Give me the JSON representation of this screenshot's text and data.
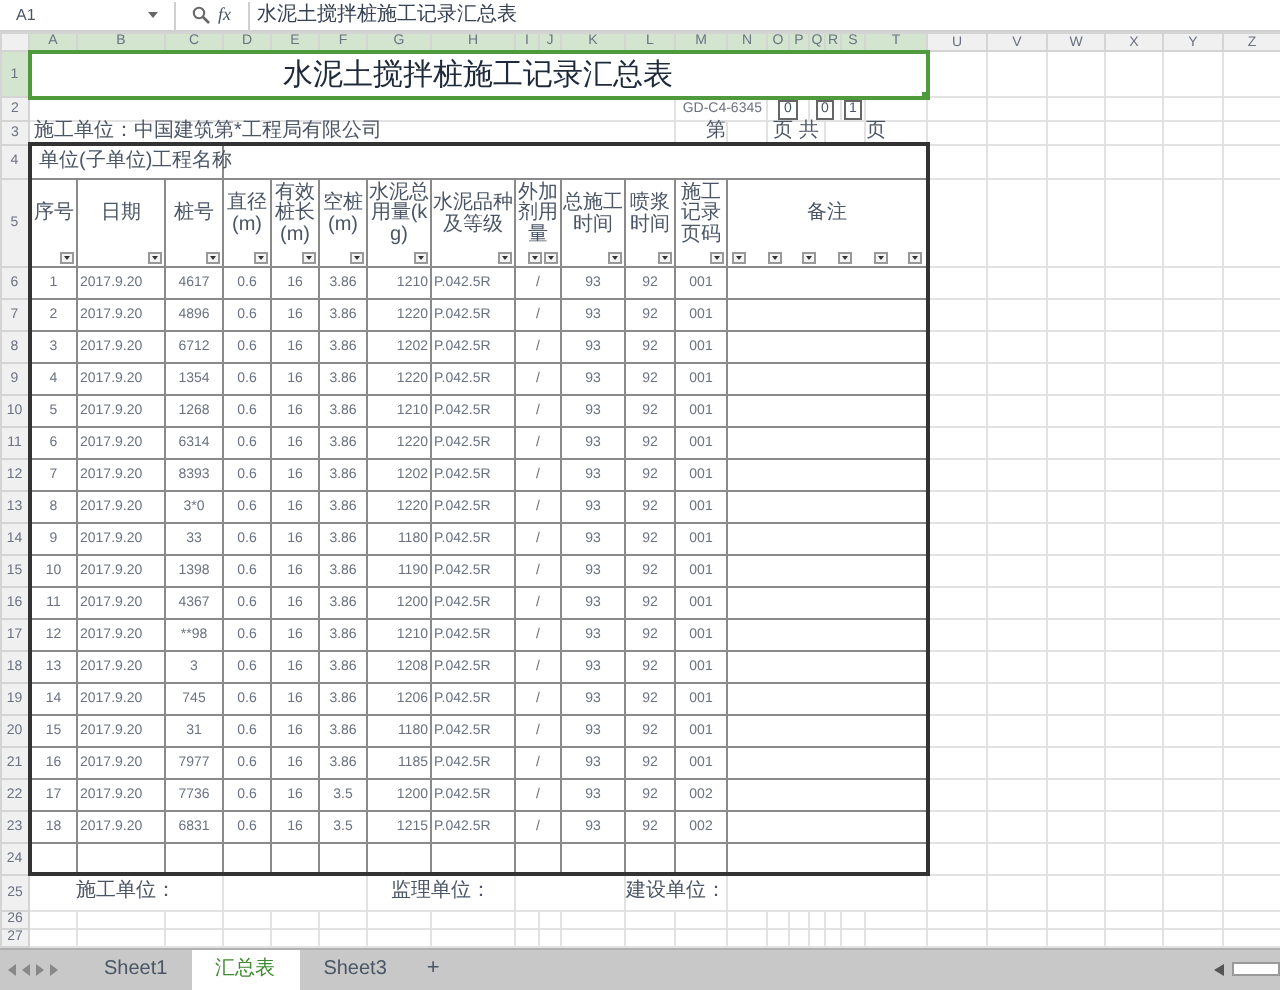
{
  "toolbar": {
    "name_box": "A1",
    "fx_label": "fx",
    "formula": "水泥土搅拌桩施工记录汇总表"
  },
  "column_letters": [
    "A",
    "B",
    "C",
    "D",
    "E",
    "F",
    "G",
    "H",
    "I",
    "J",
    "K",
    "L",
    "M",
    "N",
    "O",
    "P",
    "Q",
    "R",
    "S",
    "T",
    "U",
    "V",
    "W",
    "X",
    "Y",
    "Z"
  ],
  "row_numbers": [
    "1",
    "2",
    "3",
    "4",
    "5",
    "6",
    "7",
    "8",
    "9",
    "10",
    "11",
    "12",
    "13",
    "14",
    "15",
    "16",
    "17",
    "18",
    "19",
    "20",
    "21",
    "22",
    "23",
    "24",
    "25",
    "26",
    "27"
  ],
  "title": {
    "text": "水泥土搅拌桩施工记录汇总表",
    "selected": true
  },
  "form_code": "GD-C4-6345",
  "code_boxes": [
    "0",
    "0",
    "1"
  ],
  "construction_unit": "施工单位：中国建筑第*工程局有限公司",
  "page_labels": [
    "第",
    "页 共",
    "页"
  ],
  "project_name_label": "单位(子单位)工程名称",
  "headers": [
    "序号",
    "日期",
    "桩号",
    "直径(m)",
    "有效桩长(m)",
    "空桩(m)",
    "水泥总用量(kg)",
    "水泥品种及等级",
    "外加剂用量",
    "总施工时间",
    "喷浆时间",
    "施工记录页码",
    "备注"
  ],
  "rows": [
    {
      "no": "1",
      "date": "2017.9.20",
      "pile": "4617",
      "diameter": "0.6",
      "length": "16",
      "empty": "3.86",
      "cement": "1210",
      "grade": "P.042.5R",
      "additive": "/",
      "total_time": "93",
      "spray_time": "92",
      "page": "001"
    },
    {
      "no": "2",
      "date": "2017.9.20",
      "pile": "4896",
      "diameter": "0.6",
      "length": "16",
      "empty": "3.86",
      "cement": "1220",
      "grade": "P.042.5R",
      "additive": "/",
      "total_time": "93",
      "spray_time": "92",
      "page": "001"
    },
    {
      "no": "3",
      "date": "2017.9.20",
      "pile": "6712",
      "diameter": "0.6",
      "length": "16",
      "empty": "3.86",
      "cement": "1202",
      "grade": "P.042.5R",
      "additive": "/",
      "total_time": "93",
      "spray_time": "92",
      "page": "001"
    },
    {
      "no": "4",
      "date": "2017.9.20",
      "pile": "1354",
      "diameter": "0.6",
      "length": "16",
      "empty": "3.86",
      "cement": "1220",
      "grade": "P.042.5R",
      "additive": "/",
      "total_time": "93",
      "spray_time": "92",
      "page": "001"
    },
    {
      "no": "5",
      "date": "2017.9.20",
      "pile": "1268",
      "diameter": "0.6",
      "length": "16",
      "empty": "3.86",
      "cement": "1210",
      "grade": "P.042.5R",
      "additive": "/",
      "total_time": "93",
      "spray_time": "92",
      "page": "001"
    },
    {
      "no": "6",
      "date": "2017.9.20",
      "pile": "6314",
      "diameter": "0.6",
      "length": "16",
      "empty": "3.86",
      "cement": "1220",
      "grade": "P.042.5R",
      "additive": "/",
      "total_time": "93",
      "spray_time": "92",
      "page": "001"
    },
    {
      "no": "7",
      "date": "2017.9.20",
      "pile": "8393",
      "diameter": "0.6",
      "length": "16",
      "empty": "3.86",
      "cement": "1202",
      "grade": "P.042.5R",
      "additive": "/",
      "total_time": "93",
      "spray_time": "92",
      "page": "001"
    },
    {
      "no": "8",
      "date": "2017.9.20",
      "pile": "3*0",
      "diameter": "0.6",
      "length": "16",
      "empty": "3.86",
      "cement": "1220",
      "grade": "P.042.5R",
      "additive": "/",
      "total_time": "93",
      "spray_time": "92",
      "page": "001"
    },
    {
      "no": "9",
      "date": "2017.9.20",
      "pile": "33",
      "diameter": "0.6",
      "length": "16",
      "empty": "3.86",
      "cement": "1180",
      "grade": "P.042.5R",
      "additive": "/",
      "total_time": "93",
      "spray_time": "92",
      "page": "001"
    },
    {
      "no": "10",
      "date": "2017.9.20",
      "pile": "1398",
      "diameter": "0.6",
      "length": "16",
      "empty": "3.86",
      "cement": "1190",
      "grade": "P.042.5R",
      "additive": "/",
      "total_time": "93",
      "spray_time": "92",
      "page": "001"
    },
    {
      "no": "11",
      "date": "2017.9.20",
      "pile": "4367",
      "diameter": "0.6",
      "length": "16",
      "empty": "3.86",
      "cement": "1200",
      "grade": "P.042.5R",
      "additive": "/",
      "total_time": "93",
      "spray_time": "92",
      "page": "001"
    },
    {
      "no": "12",
      "date": "2017.9.20",
      "pile": "**98",
      "diameter": "0.6",
      "length": "16",
      "empty": "3.86",
      "cement": "1210",
      "grade": "P.042.5R",
      "additive": "/",
      "total_time": "93",
      "spray_time": "92",
      "page": "001"
    },
    {
      "no": "13",
      "date": "2017.9.20",
      "pile": "3",
      "diameter": "0.6",
      "length": "16",
      "empty": "3.86",
      "cement": "1208",
      "grade": "P.042.5R",
      "additive": "/",
      "total_time": "93",
      "spray_time": "92",
      "page": "001"
    },
    {
      "no": "14",
      "date": "2017.9.20",
      "pile": "745",
      "diameter": "0.6",
      "length": "16",
      "empty": "3.86",
      "cement": "1206",
      "grade": "P.042.5R",
      "additive": "/",
      "total_time": "93",
      "spray_time": "92",
      "page": "001"
    },
    {
      "no": "15",
      "date": "2017.9.20",
      "pile": "31",
      "diameter": "0.6",
      "length": "16",
      "empty": "3.86",
      "cement": "1180",
      "grade": "P.042.5R",
      "additive": "/",
      "total_time": "93",
      "spray_time": "92",
      "page": "001"
    },
    {
      "no": "16",
      "date": "2017.9.20",
      "pile": "7977",
      "diameter": "0.6",
      "length": "16",
      "empty": "3.86",
      "cement": "1185",
      "grade": "P.042.5R",
      "additive": "/",
      "total_time": "93",
      "spray_time": "92",
      "page": "001"
    },
    {
      "no": "17",
      "date": "2017.9.20",
      "pile": "7736",
      "diameter": "0.6",
      "length": "16",
      "empty": "3.5",
      "cement": "1200",
      "grade": "P.042.5R",
      "additive": "/",
      "total_time": "93",
      "spray_time": "92",
      "page": "002"
    },
    {
      "no": "18",
      "date": "2017.9.20",
      "pile": "6831",
      "diameter": "0.6",
      "length": "16",
      "empty": "3.5",
      "cement": "1215",
      "grade": "P.042.5R",
      "additive": "/",
      "total_time": "93",
      "spray_time": "92",
      "page": "002"
    }
  ],
  "signatures": [
    "施工单位：",
    "监理单位：",
    "建设单位："
  ],
  "sheet_tabs": [
    {
      "label": "Sheet1",
      "selected": false
    },
    {
      "label": "汇总表",
      "selected": true
    },
    {
      "label": "Sheet3",
      "selected": false
    }
  ],
  "add_sheet": "+"
}
